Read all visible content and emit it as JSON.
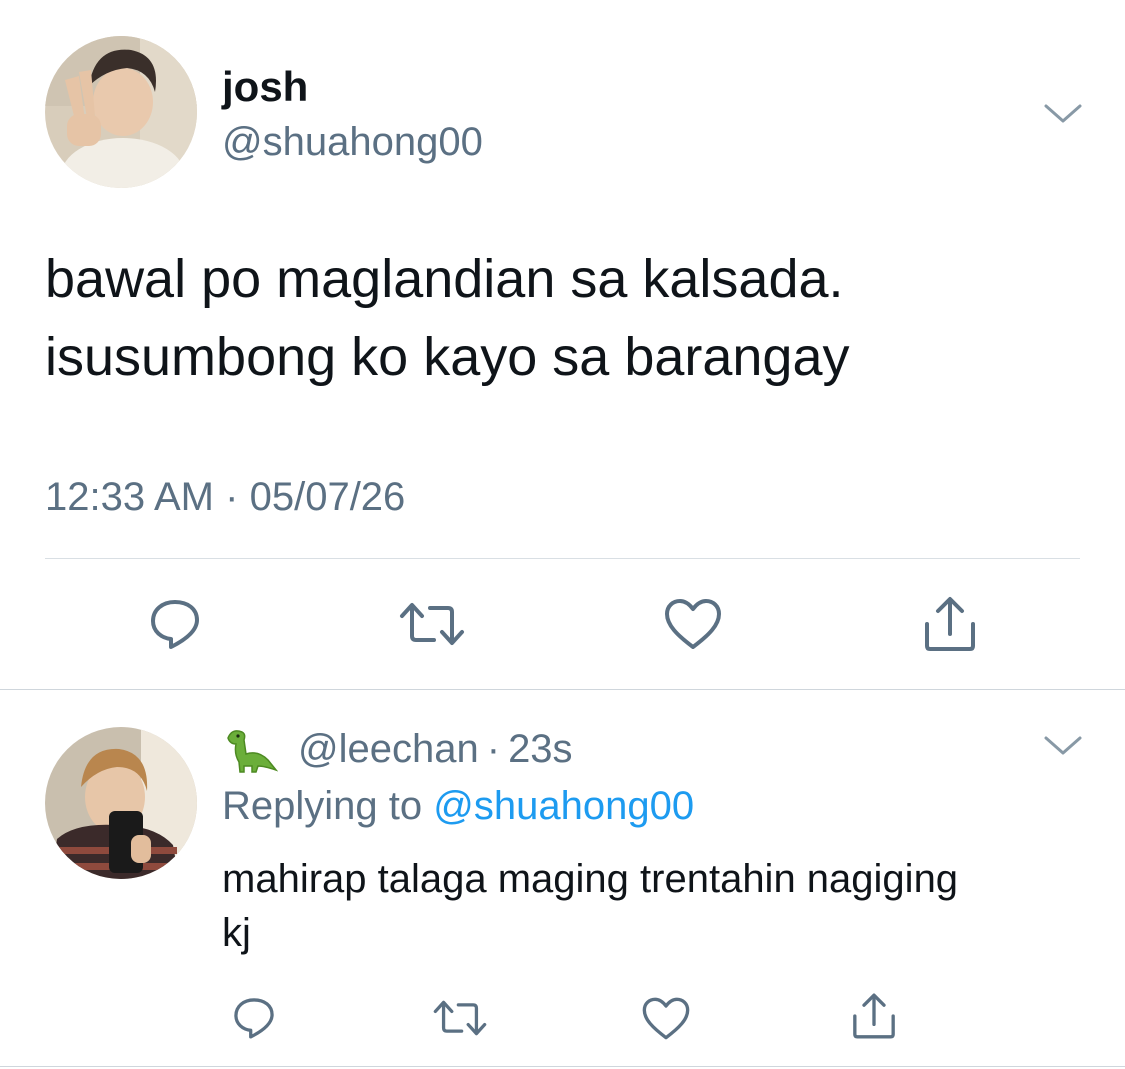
{
  "tweet": {
    "author": {
      "display_name": "josh",
      "handle": "@shuahong00",
      "avatar_icon": "profile-photo"
    },
    "text_lines": [
      "bawal po maglandian sa kalsada.",
      "isusumbong ko kayo sa barangay"
    ],
    "time": "12:33 AM",
    "separator": "·",
    "date": "05/07/26",
    "actions": [
      "reply-icon",
      "retweet-icon",
      "like-icon",
      "share-icon"
    ]
  },
  "reply": {
    "author": {
      "handle": "@leechan",
      "badge_icon": "dinosaur-emoji",
      "avatar_icon": "profile-photo"
    },
    "separator": "·",
    "age": "23s",
    "replying_prefix": "Replying to",
    "replying_mention": "@shuahong00",
    "text_lines": [
      "mahirap talaga maging trentahin nagiging",
      "kj"
    ],
    "actions": [
      "reply-icon",
      "retweet-icon",
      "like-icon",
      "share-icon"
    ]
  },
  "colors": {
    "text_primary": "#0f1419",
    "text_secondary": "#5b7083",
    "mention": "#1d9bf0",
    "divider": "#d9dfe4"
  }
}
